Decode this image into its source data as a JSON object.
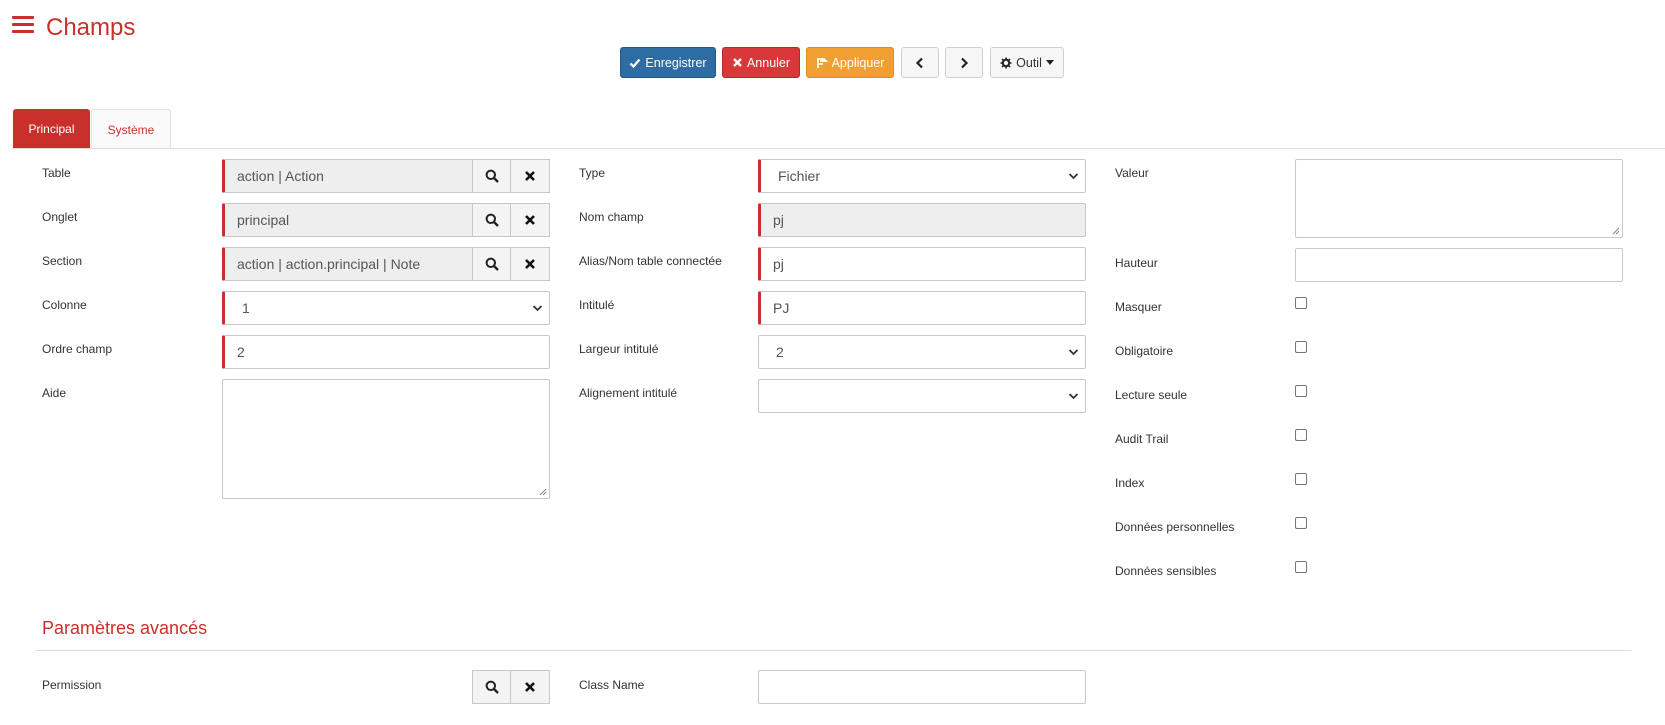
{
  "header": {
    "title": "Champs",
    "menu_icon": "hamburger-icon"
  },
  "toolbar": {
    "save": "Enregistrer",
    "cancel": "Annuler",
    "apply": "Appliquer",
    "prev_icon": "chevron-left-icon",
    "next_icon": "chevron-right-icon",
    "tools": "Outil"
  },
  "tabs": [
    {
      "label": "Principal",
      "active": true
    },
    {
      "label": "Système",
      "active": false
    }
  ],
  "form": {
    "table": {
      "label": "Table",
      "value": "action | Action"
    },
    "onglet": {
      "label": "Onglet",
      "value": "principal"
    },
    "section": {
      "label": "Section",
      "value": "action | action.principal | Note"
    },
    "colonne": {
      "label": "Colonne",
      "value": "1"
    },
    "ordre": {
      "label": "Ordre champ",
      "value": "2"
    },
    "aide": {
      "label": "Aide",
      "value": ""
    },
    "type": {
      "label": "Type",
      "value": "Fichier"
    },
    "nom_champ": {
      "label": "Nom champ",
      "value": "pj"
    },
    "alias": {
      "label": "Alias/Nom table connectée",
      "value": "pj"
    },
    "intitule": {
      "label": "Intitulé",
      "value": "PJ"
    },
    "largeur": {
      "label": "Largeur intitulé",
      "value": "2"
    },
    "alignement": {
      "label": "Alignement intitulé",
      "value": ""
    },
    "valeur": {
      "label": "Valeur",
      "value": ""
    },
    "hauteur": {
      "label": "Hauteur",
      "value": ""
    },
    "checkboxes": [
      {
        "label": "Masquer",
        "checked": false
      },
      {
        "label": "Obligatoire",
        "checked": false
      },
      {
        "label": "Lecture seule",
        "checked": false
      },
      {
        "label": "Audit Trail",
        "checked": false
      },
      {
        "label": "Index",
        "checked": false
      },
      {
        "label": "Données personnelles",
        "checked": false
      },
      {
        "label": "Données sensibles",
        "checked": false
      }
    ]
  },
  "advanced": {
    "title": "Paramètres avancés",
    "permission": {
      "label": "Permission",
      "value": ""
    },
    "class_name": {
      "label": "Class Name",
      "value": ""
    }
  },
  "colors": {
    "accent": "#c9302c",
    "primary": "#2e6da4",
    "danger": "#d9383a",
    "warning": "#f0a030"
  }
}
